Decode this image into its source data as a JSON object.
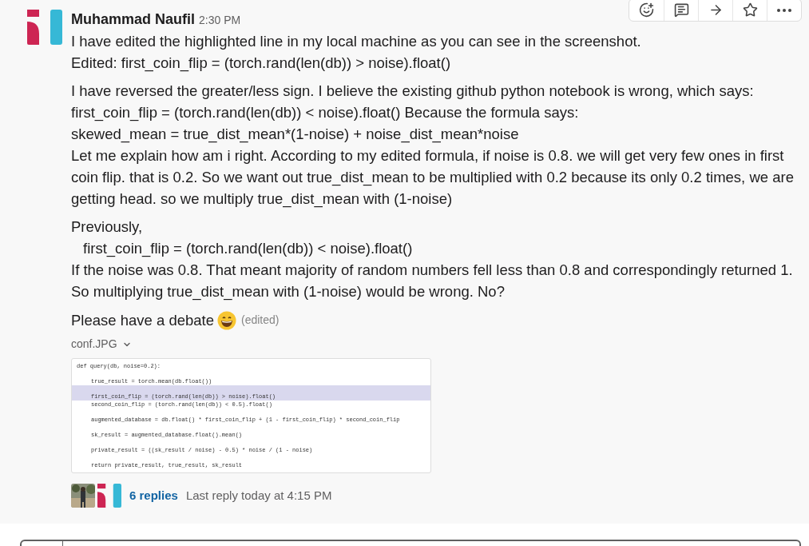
{
  "toolbar": {
    "buttons": [
      {
        "kind": "reaction"
      },
      {
        "kind": "thread"
      },
      {
        "kind": "share"
      },
      {
        "kind": "save"
      },
      {
        "kind": "more"
      }
    ]
  },
  "message": {
    "author": "Muhammad Naufil",
    "time": "2:30 PM",
    "paragraphs": [
      {
        "lines": [
          {
            "text": "I have edited the highlighted line in my local machine as you can see in the screenshot.",
            "indented": false
          },
          {
            "text": "Edited: first_coin_flip = (torch.rand(len(db)) > noise).float()",
            "indented": false
          }
        ]
      },
      {
        "lines": [
          {
            "text": "I have reversed  the greater/less sign. I believe the existing github python notebook is wrong, which says:",
            "indented": false
          },
          {
            "text": "first_coin_flip = (torch.rand(len(db)) < noise).float() Because the formula says:",
            "indented": false
          },
          {
            "text": "skewed_mean = true_dist_mean*(1-noise) + noise_dist_mean*noise",
            "indented": false
          },
          {
            "text": "Let me explain how am i right. According to my edited formula, if noise is 0.8. we will get very few ones in first coin flip. that is 0.2. So we want out true_dist_mean to be multiplied with 0.2 because its only 0.2 times, we are getting head. so we multiply true_dist_mean with (1-noise)",
            "indented": false
          }
        ]
      },
      {
        "lines": [
          {
            "text": "Previously,",
            "indented": false
          },
          {
            "text": "first_coin_flip = (torch.rand(len(db)) < noise).float()",
            "indented": true
          },
          {
            "text": "If the noise was 0.8. That meant majority of random numbers fell less than 0.8 and correspondingly returned 1.",
            "indented": false
          },
          {
            "text": "So multiplying true_dist_mean with (1-noise) would be wrong. No?",
            "indented": false
          }
        ]
      }
    ],
    "last_line": {
      "text": "Please have a debate",
      "edited": "(edited)"
    },
    "attachment": {
      "name": "conf.JPG",
      "code": [
        {
          "text": "def query(db, noise=0.2):",
          "indented": false,
          "spaced": false,
          "highlighted": false
        },
        {
          "text": "true_result = torch.mean(db.float())",
          "indented": true,
          "spaced": true,
          "highlighted": false
        },
        {
          "text": "first_coin_flip = (torch.rand(len(db)) > noise).float()",
          "indented": true,
          "spaced": true,
          "highlighted": true
        },
        {
          "text": "second_coin_flip = (torch.rand(len(db)) < 0.5).float()",
          "indented": true,
          "spaced": false,
          "highlighted": false
        },
        {
          "text": "augmented_database = db.float() * first_coin_flip + (1 - first_coin_flip) * second_coin_flip",
          "indented": true,
          "spaced": true,
          "highlighted": false
        },
        {
          "text": "sk_result = augmented_database.float().mean()",
          "indented": true,
          "spaced": true,
          "highlighted": false
        },
        {
          "text": "private_result = ((sk_result / noise) - 0.5) * noise / (1 - noise)",
          "indented": true,
          "spaced": true,
          "highlighted": false
        },
        {
          "text": "return private_result, true_result, sk_result",
          "indented": true,
          "spaced": true,
          "highlighted": false
        }
      ]
    },
    "replies": {
      "count": "6 replies",
      "last": "Last reply today at 4:15 PM"
    }
  }
}
